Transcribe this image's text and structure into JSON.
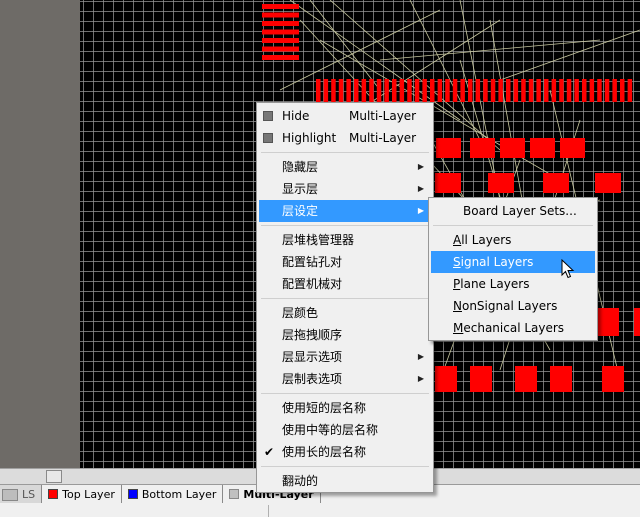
{
  "context_menu": {
    "items": [
      {
        "label": "Hide",
        "value": "Multi-Layer"
      },
      {
        "label": "Highlight",
        "value": "Multi-Layer"
      },
      {
        "label": "隐藏层"
      },
      {
        "label": "显示层"
      },
      {
        "label": "层设定"
      },
      {
        "label": "层堆栈管理器"
      },
      {
        "label": "配置钻孔对"
      },
      {
        "label": "配置机械对"
      },
      {
        "label": "层颜色"
      },
      {
        "label": "层拖拽顺序"
      },
      {
        "label": "层显示选项"
      },
      {
        "label": "层制表选项"
      },
      {
        "label": "使用短的层名称"
      },
      {
        "label": "使用中等的层名称"
      },
      {
        "label": "使用长的层名称"
      },
      {
        "label": "翻动的"
      }
    ],
    "checked_item": "使用长的层名称",
    "highlighted_item": "层设定"
  },
  "submenu": {
    "board_layer_sets": "Board Layer Sets...",
    "items": [
      {
        "mnemonic": "A",
        "rest": "ll Layers"
      },
      {
        "mnemonic": "S",
        "rest": "ignal Layers"
      },
      {
        "mnemonic": "P",
        "rest": "lane Layers"
      },
      {
        "mnemonic": "N",
        "rest": "onSignal Layers"
      },
      {
        "mnemonic": "M",
        "rest": "echanical Layers"
      }
    ],
    "highlighted_item": "Signal Layers"
  },
  "layer_tabs": {
    "ls": "LS",
    "tabs": [
      {
        "label": "Top Layer",
        "color": "#ff0000"
      },
      {
        "label": "Bottom Layer",
        "color": "#0000ff"
      },
      {
        "label": "Multi-Layer",
        "color": "#c0c0c0"
      }
    ],
    "active_tab": "Multi-Layer"
  },
  "colors": {
    "pad_red": "#ff0000",
    "selection_blue": "#3399ff",
    "ratsnest": "#c8c8a0"
  }
}
